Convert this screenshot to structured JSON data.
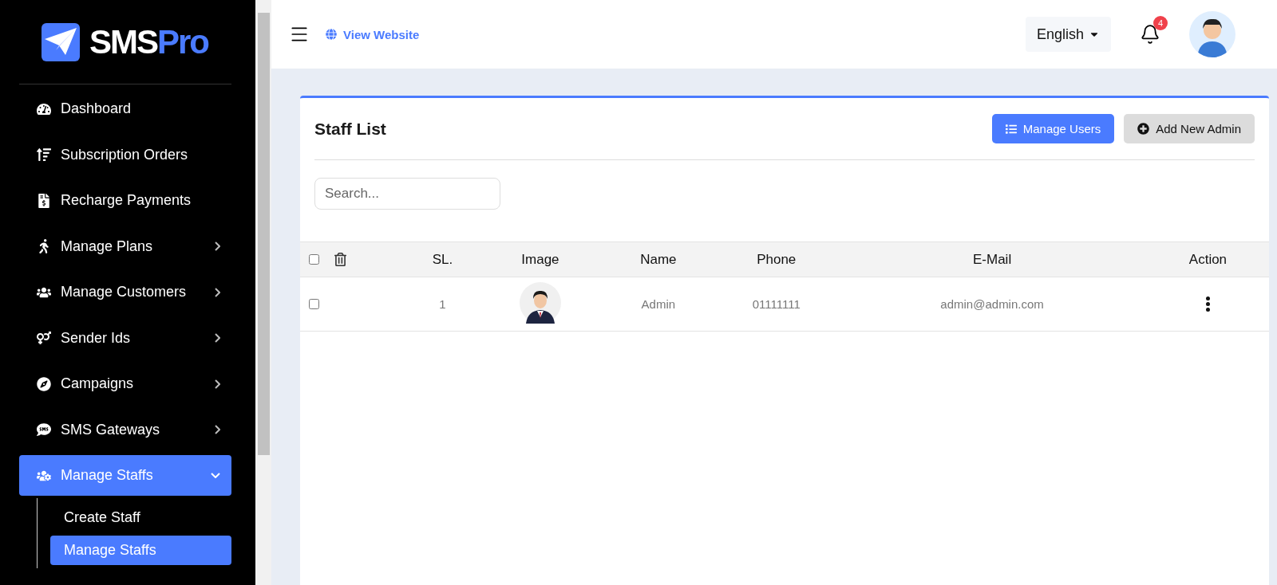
{
  "logo": {
    "part1": "SMS",
    "part2": "Pro"
  },
  "sidebar": {
    "items": [
      {
        "label": "Dashboard",
        "kind": "link",
        "selected": false
      },
      {
        "label": "Subscription Orders",
        "kind": "link",
        "selected": false
      },
      {
        "label": "Recharge Payments",
        "kind": "link",
        "selected": false
      },
      {
        "label": "Manage Plans",
        "kind": "group",
        "expanded": false,
        "selected": false
      },
      {
        "label": "Manage Customers",
        "kind": "group",
        "expanded": false,
        "selected": false
      },
      {
        "label": "Sender Ids",
        "kind": "group",
        "expanded": false,
        "selected": false
      },
      {
        "label": "Campaigns",
        "kind": "group",
        "expanded": false,
        "selected": false
      },
      {
        "label": "SMS Gateways",
        "kind": "group",
        "expanded": false,
        "selected": false
      },
      {
        "label": "Manage Staffs",
        "kind": "group",
        "expanded": true,
        "selected": true,
        "children": [
          {
            "label": "Create Staff",
            "selected": false
          },
          {
            "label": "Manage Staffs",
            "selected": true
          }
        ]
      }
    ]
  },
  "header": {
    "view_website": "View Website",
    "language": "English",
    "notification_count": "4"
  },
  "card": {
    "title": "Staff List",
    "buttons": [
      {
        "label": "Manage Users",
        "kind": "primary"
      },
      {
        "label": "Add New Admin",
        "kind": "secondary"
      }
    ],
    "search": {
      "placeholder": "Search..."
    },
    "table": {
      "columns": [
        "SL.",
        "Image",
        "Name",
        "Phone",
        "E-Mail",
        "Action"
      ],
      "all_checked": false,
      "rows": [
        {
          "checked": false,
          "sl": "1",
          "name": "Admin",
          "phone": "01111111",
          "email": "admin@admin.com"
        }
      ]
    }
  }
}
